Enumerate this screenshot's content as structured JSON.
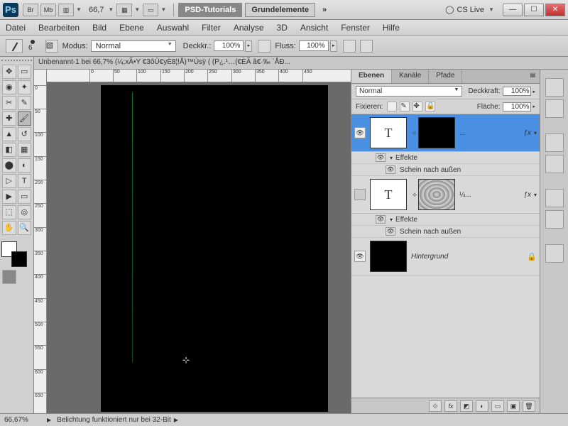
{
  "titlebar": {
    "zoom": "66,7",
    "workspaces": [
      "PSD-Tutorials",
      "Grundelemente"
    ],
    "cslive": "CS Live",
    "icons": [
      "Br",
      "Mb"
    ]
  },
  "menu": [
    "Datei",
    "Bearbeiten",
    "Bild",
    "Ebene",
    "Auswahl",
    "Filter",
    "Analyse",
    "3D",
    "Ansicht",
    "Fenster",
    "Hilfe"
  ],
  "options": {
    "brush_size": "6",
    "modus_label": "Modus:",
    "modus_value": "Normal",
    "deckkr_label": "Deckkr.:",
    "deckkr_value": "100%",
    "fluss_label": "Fluss:",
    "fluss_value": "100%"
  },
  "document": {
    "tab": "Unbenannt-1 bei 66,7% (¼;xÃ•Y €3ôÚ€yÈ8¦!Å)™Ùsÿ      (  (P¿.¹…(€ÈÃ â€·‰ ´ÅÐ...",
    "ruler_h": [
      "0",
      "50",
      "100",
      "150",
      "200",
      "250",
      "300",
      "350",
      "400",
      "450"
    ],
    "ruler_v": [
      "0",
      "50",
      "100",
      "150",
      "200",
      "250",
      "300",
      "350",
      "400",
      "450",
      "500",
      "550",
      "600",
      "650"
    ]
  },
  "layers_panel": {
    "tabs": [
      "Ebenen",
      "Kanäle",
      "Pfade"
    ],
    "blend_mode": "Normal",
    "deckkraft_label": "Deckkraft:",
    "deckkraft_value": "100%",
    "fixieren_label": "Fixieren:",
    "flaeche_label": "Fläche:",
    "flaeche_value": "100%",
    "layers": [
      {
        "type": "text",
        "name": "...",
        "fx": "ƒx",
        "selected": true,
        "visible": true,
        "effects_label": "Effekte",
        "effect1": "Schein nach außen"
      },
      {
        "type": "text",
        "name": "¼...",
        "fx": "ƒx",
        "selected": false,
        "visible": false,
        "effects_label": "Effekte",
        "effect1": "Schein nach außen"
      },
      {
        "type": "bg",
        "name": "Hintergrund",
        "locked": true,
        "visible": true
      }
    ]
  },
  "status": {
    "zoom": "66,67%",
    "message": "Belichtung funktioniert nur bei 32-Bit"
  }
}
